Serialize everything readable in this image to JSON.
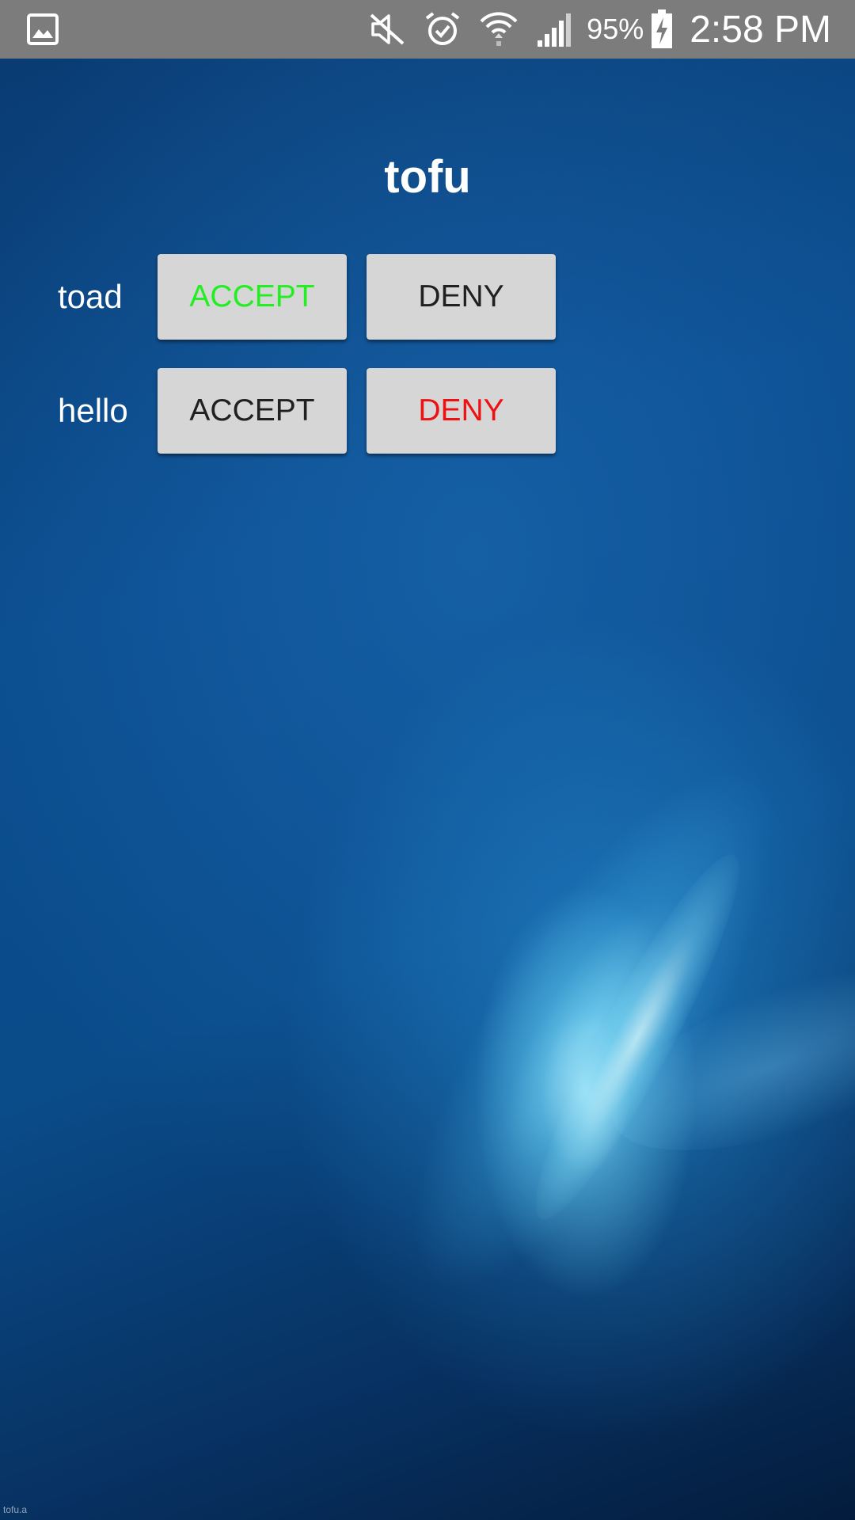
{
  "status_bar": {
    "left_icon": "gallery-notification-icon",
    "icons": [
      "mute-icon",
      "alarm-icon",
      "wifi-icon",
      "cell-signal-icon"
    ],
    "battery_percent": "95%",
    "battery_icon": "battery-charging-icon",
    "time": "2:58 PM"
  },
  "page": {
    "title": "tofu",
    "watermark": "tofu.a"
  },
  "requests": [
    {
      "name": "toad",
      "accept_label": "ACCEPT",
      "deny_label": "DENY",
      "accept_color": "#22ee22",
      "deny_color": "#202020"
    },
    {
      "name": "hello",
      "accept_label": "ACCEPT",
      "deny_label": "DENY",
      "accept_color": "#202020",
      "deny_color": "#ee1111"
    }
  ],
  "colors": {
    "status_bar": "#7c7c7c",
    "button_bg": "#d6d6d6",
    "text": "#ffffff"
  }
}
